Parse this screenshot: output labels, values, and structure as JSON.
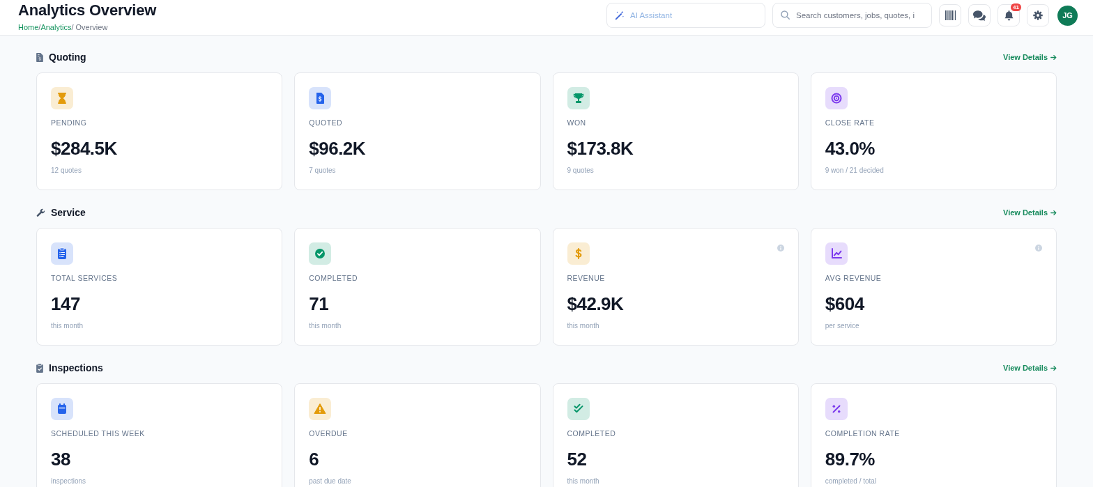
{
  "header": {
    "title": "Analytics Overview",
    "breadcrumb": [
      {
        "label": "Home",
        "current": false,
        "separator": "/"
      },
      {
        "label": "Analytics",
        "current": false,
        "separator": "/"
      },
      {
        "label": "Overview",
        "current": true
      }
    ]
  },
  "assistant": {
    "placeholder": "AI Assistant"
  },
  "search": {
    "placeholder": "Search customers, jobs, quotes, i"
  },
  "toolbar": [
    {
      "kind": "barcode"
    },
    {
      "kind": "chat"
    },
    {
      "kind": "bell",
      "badge": "41"
    },
    {
      "kind": "settings"
    }
  ],
  "avatar": {
    "initials": "JG"
  },
  "sections": [
    {
      "title": "Quoting",
      "kind": "file-invoice",
      "link": "View Details",
      "cards": [
        {
          "kind": "hourglass",
          "color": "#e39b0b",
          "info": false,
          "label": "PENDING",
          "value": "$284.5K",
          "note": "12 quotes"
        },
        {
          "kind": "file-dollar",
          "color": "#2563eb",
          "info": false,
          "label": "QUOTED",
          "value": "$96.2K",
          "note": "7 quotes"
        },
        {
          "kind": "trophy",
          "color": "#059669",
          "info": false,
          "label": "WON",
          "value": "$173.8K",
          "note": "9 quotes"
        },
        {
          "kind": "target",
          "color": "#7c3aed",
          "info": false,
          "label": "CLOSE RATE",
          "value": "43.0%",
          "note": "9 won / 21 decided"
        }
      ]
    },
    {
      "title": "Service",
      "kind": "wrench",
      "link": "View Details",
      "cards": [
        {
          "kind": "clipboard-list",
          "color": "#2563eb",
          "info": false,
          "label": "TOTAL SERVICES",
          "value": "147",
          "note": "this month"
        },
        {
          "kind": "check-circle",
          "color": "#059669",
          "info": false,
          "label": "COMPLETED",
          "value": "71",
          "note": "this month"
        },
        {
          "kind": "dollar",
          "color": "#e39b0b",
          "info": true,
          "label": "REVENUE",
          "value": "$42.9K",
          "note": "this month"
        },
        {
          "kind": "chart-line",
          "color": "#7c3aed",
          "info": true,
          "label": "AVG REVENUE",
          "value": "$604",
          "note": "per service"
        }
      ]
    },
    {
      "title": "Inspections",
      "kind": "clipboard-check",
      "link": "View Details",
      "cards": [
        {
          "kind": "calendar",
          "color": "#2563eb",
          "info": false,
          "label": "SCHEDULED THIS WEEK",
          "value": "38",
          "note": "inspections"
        },
        {
          "kind": "warning",
          "color": "#e39b0b",
          "info": false,
          "label": "OVERDUE",
          "value": "6",
          "note": "past due date"
        },
        {
          "kind": "double-check",
          "color": "#059669",
          "info": false,
          "label": "COMPLETED",
          "value": "52",
          "note": "this month"
        },
        {
          "kind": "percent",
          "color": "#7c3aed",
          "info": false,
          "label": "COMPLETION RATE",
          "value": "89.7%",
          "note": "completed / total"
        }
      ]
    }
  ]
}
